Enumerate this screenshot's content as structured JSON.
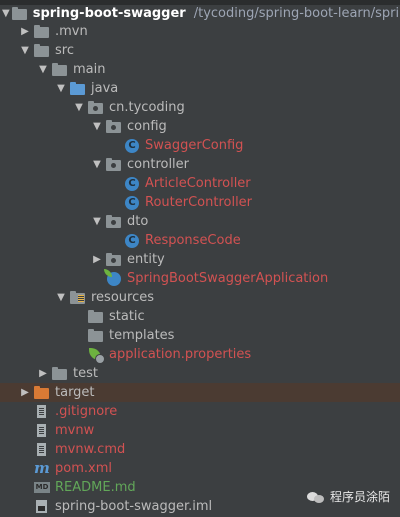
{
  "project": {
    "root_name": "spring-boot-swagger",
    "root_path": "/tycoding/spring-boot-learn/spring-"
  },
  "tree": {
    "mvn": ".mvn",
    "src": "src",
    "main": "main",
    "java": "java",
    "package": "cn.tycoding",
    "config": "config",
    "swagger_config": "SwaggerConfig",
    "controller": "controller",
    "article_controller": "ArticleController",
    "router_controller": "RouterController",
    "dto": "dto",
    "response_code": "ResponseCode",
    "entity": "entity",
    "app_class": "SpringBootSwaggerApplication",
    "resources": "resources",
    "static": "static",
    "templates": "templates",
    "app_properties": "application.properties",
    "test": "test",
    "target": "target",
    "gitignore": ".gitignore",
    "mvnw": "mvnw",
    "mvnw_cmd": "mvnw.cmd",
    "pom": "pom.xml",
    "readme": "README.md",
    "iml": "spring-boot-swagger.iml"
  },
  "icons": {
    "class_letter": "C",
    "md_badge": "MD",
    "maven_letter": "m"
  },
  "colors": {
    "background": "#3c3f41",
    "modified_file": "#d25252",
    "new_file": "#62a759",
    "folder_blue": "#5b9ad5",
    "folder_orange": "#d97a35",
    "selected_row": "#4b3b32"
  },
  "watermark": {
    "text": "程序员涂陌"
  }
}
